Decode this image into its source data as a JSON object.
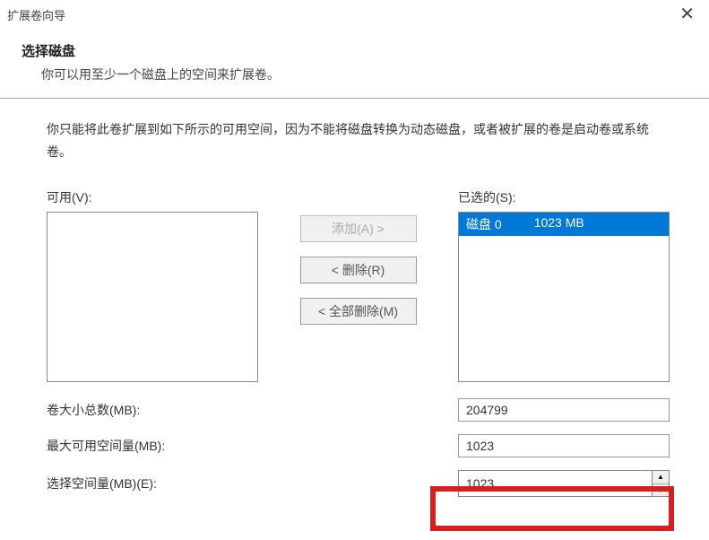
{
  "titlebar": {
    "title": "扩展卷向导"
  },
  "header": {
    "heading": "选择磁盘",
    "subtext": "你可以用至少一个磁盘上的空间来扩展卷。"
  },
  "info": "你只能将此卷扩展到如下所示的可用空间，因为不能将磁盘转换为动态磁盘，或者被扩展的卷是启动卷或系统卷。",
  "lists": {
    "available_label": "可用(V):",
    "selected_label": "已选的(S):",
    "selected_item_disk": "磁盘 0",
    "selected_item_size": "1023 MB"
  },
  "buttons": {
    "add": "添加(A) >",
    "remove": "< 删除(R)",
    "remove_all": "< 全部删除(M)"
  },
  "fields": {
    "total_label": "卷大小总数(MB):",
    "total_value": "204799",
    "max_label": "最大可用空间量(MB):",
    "max_value": "1023",
    "select_label": "选择空间量(MB)(E):",
    "select_value": "1023"
  }
}
